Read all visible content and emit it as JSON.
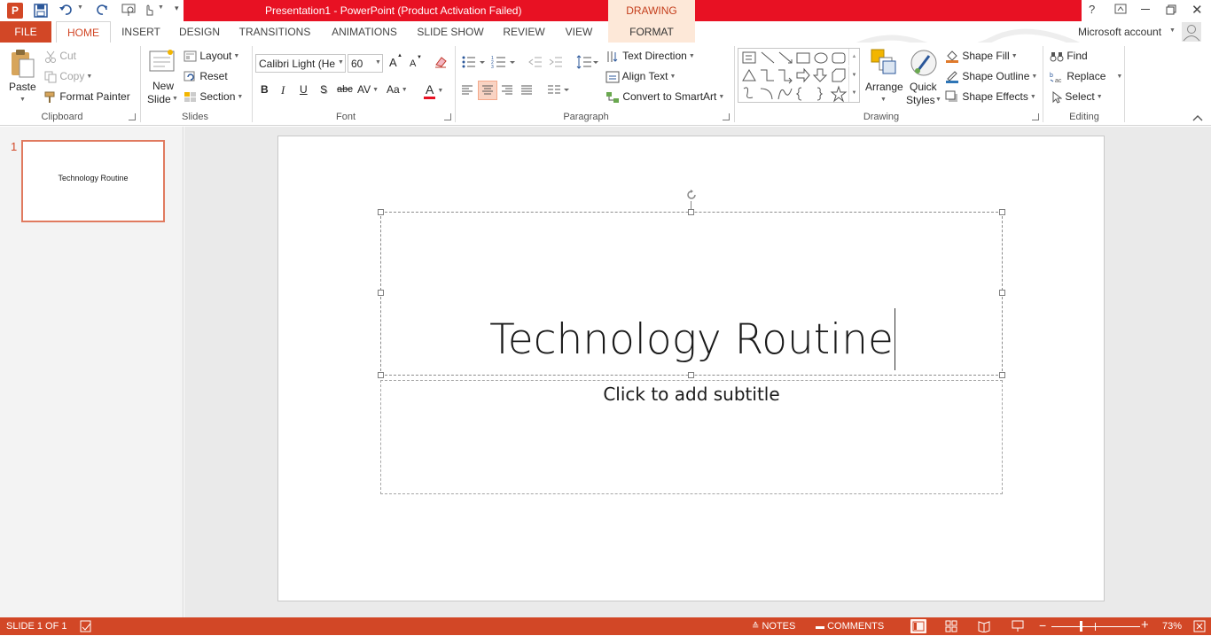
{
  "app": {
    "title": "Presentation1 -  PowerPoint (Product Activation Failed)",
    "context_tab_group": "DRAWING TOOLS",
    "account": "Microsoft account",
    "window_buttons": [
      "?",
      "⇱",
      "—",
      "❐",
      "✕"
    ]
  },
  "tabs": [
    "FILE",
    "HOME",
    "INSERT",
    "DESIGN",
    "TRANSITIONS",
    "ANIMATIONS",
    "SLIDE SHOW",
    "REVIEW",
    "VIEW",
    "FORMAT"
  ],
  "clipboard": {
    "paste": "Paste",
    "cut": "Cut",
    "copy": "Copy",
    "format_painter": "Format Painter",
    "group_label": "Clipboard"
  },
  "slides_group": {
    "new_slide_1": "New",
    "new_slide_2": "Slide",
    "layout": "Layout",
    "reset": "Reset",
    "section": "Section",
    "group_label": "Slides"
  },
  "font": {
    "font_name": "Calibri Light (He",
    "font_size": "60",
    "bold": "B",
    "italic": "I",
    "underline": "U",
    "shadow": "S",
    "strike": "abc",
    "spacing": "AV",
    "case": "Aa",
    "color_letter": "A",
    "grow": "A",
    "shrink": "A",
    "group_label": "Font"
  },
  "paragraph": {
    "text_direction": "Text Direction",
    "align_text": "Align Text",
    "convert_smartart": "Convert to SmartArt",
    "group_label": "Paragraph"
  },
  "drawing": {
    "arrange": "Arrange",
    "quick_styles_1": "Quick",
    "quick_styles_2": "Styles",
    "shape_fill": "Shape Fill",
    "shape_outline": "Shape Outline",
    "shape_effects": "Shape Effects",
    "group_label": "Drawing"
  },
  "editing": {
    "find": "Find",
    "replace": "Replace",
    "select": "Select",
    "group_label": "Editing"
  },
  "thumbnail": {
    "number": "1",
    "title": "Technology Routine"
  },
  "slide": {
    "title": "Technology Routine",
    "subtitle_placeholder": "Click to add subtitle"
  },
  "status": {
    "slide_info": "SLIDE 1 OF 1",
    "notes": "NOTES",
    "comments": "COMMENTS",
    "zoom": "73%"
  },
  "colors": {
    "accent": "#d24726",
    "title_bar_error": "#e81123",
    "context_tab": "#fde8d8"
  }
}
